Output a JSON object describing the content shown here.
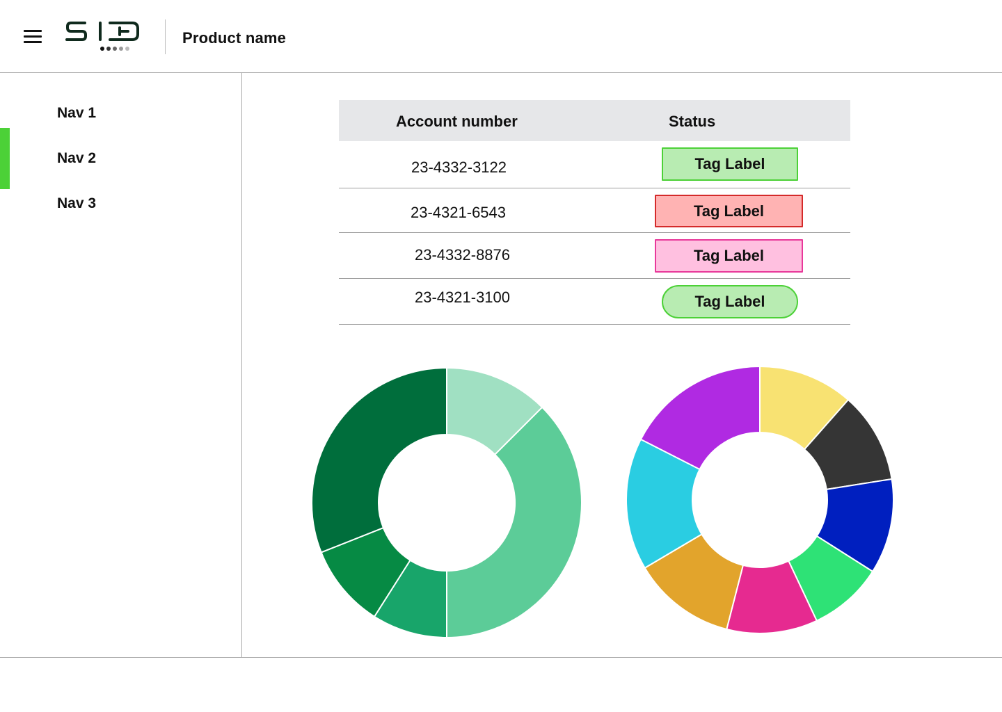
{
  "header": {
    "product_name": "Product name",
    "menu_icon": "hamburger-icon",
    "logo_icon": "brand-logo"
  },
  "sidebar": {
    "items": [
      {
        "label": "Nav 1",
        "active": false
      },
      {
        "label": "Nav 2",
        "active": true
      },
      {
        "label": "Nav 3",
        "active": false
      }
    ],
    "active_color": "#4cd137"
  },
  "table": {
    "columns": [
      "Account number",
      "Status"
    ],
    "rows": [
      {
        "account": "23-4332-3122",
        "tag": {
          "label": "Tag Label",
          "fill": "#b8ecb2",
          "border": "#4cd137",
          "shape": "rect"
        }
      },
      {
        "account": "23-4321-6543",
        "tag": {
          "label": "Tag Label",
          "fill": "#ffb3b3",
          "border": "#d42a2a",
          "shape": "rect"
        }
      },
      {
        "account": "23-4332-8876",
        "tag": {
          "label": "Tag Label",
          "fill": "#ffc0e0",
          "border": "#e8389a",
          "shape": "rect"
        }
      },
      {
        "account": "23-4321-3100",
        "tag": {
          "label": "Tag Label",
          "fill": "#b8ecb2",
          "border": "#4cd137",
          "shape": "pill"
        }
      }
    ]
  },
  "chart_data": [
    {
      "type": "pie",
      "donut": true,
      "slices": [
        {
          "value": 12.5,
          "color": "#a0e0c2"
        },
        {
          "value": 37.5,
          "color": "#5ccc98"
        },
        {
          "value": 9,
          "color": "#18a56a"
        },
        {
          "value": 10,
          "color": "#068a44"
        },
        {
          "value": 31,
          "color": "#006e3c"
        }
      ]
    },
    {
      "type": "pie",
      "donut": true,
      "slices": [
        {
          "value": 11.5,
          "color": "#f8e272"
        },
        {
          "value": 11,
          "color": "#353535"
        },
        {
          "value": 11.5,
          "color": "#001fbf"
        },
        {
          "value": 9,
          "color": "#2ee276"
        },
        {
          "value": 11,
          "color": "#e62a90"
        },
        {
          "value": 12.5,
          "color": "#e2a42c"
        },
        {
          "value": 16,
          "color": "#2acde2"
        },
        {
          "value": 17.5,
          "color": "#b02ae2"
        }
      ]
    }
  ]
}
